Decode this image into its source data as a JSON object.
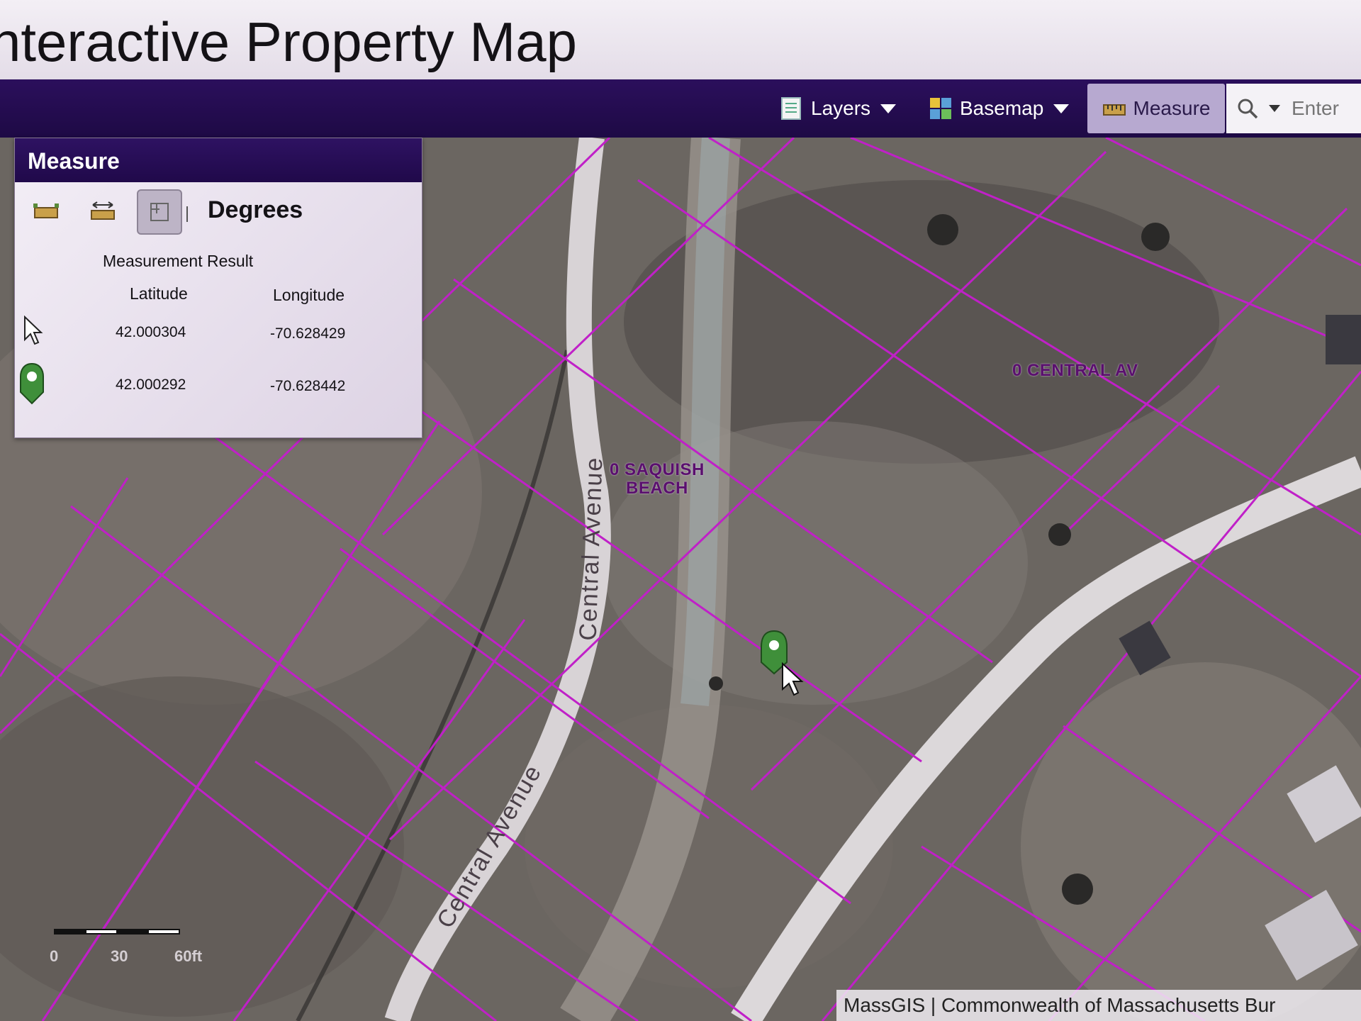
{
  "header": {
    "title": "nteractive Property Map"
  },
  "toolbar": {
    "layers_label": "Layers",
    "basemap_label": "Basemap",
    "measure_label": "Measure",
    "search_placeholder": "Enter",
    "icons": [
      "layers-icon",
      "basemap-grid-icon",
      "measure-ruler-icon",
      "search-icon"
    ]
  },
  "measure_panel": {
    "title": "Measure",
    "tools": [
      "area-tool-icon",
      "distance-tool-icon",
      "location-tool-icon"
    ],
    "active_tool": "location-tool-icon",
    "units_label": "Degrees",
    "result_title": "Measurement Result",
    "columns": {
      "latitude": "Latitude",
      "longitude": "Longitude"
    },
    "rows": [
      {
        "icon": "cursor-icon",
        "latitude": "42.000304",
        "longitude": "-70.628429"
      },
      {
        "icon": "green-marker-icon",
        "latitude": "42.000292",
        "longitude": "-70.628442"
      }
    ]
  },
  "map": {
    "road_labels": [
      "Central Avenue",
      "Central Avenue"
    ],
    "parcel_labels": [
      {
        "line1": "0 SAQUISH",
        "line2": "BEACH"
      },
      {
        "line1": "0 CENTRAL AV",
        "line2": ""
      }
    ],
    "scalebar": {
      "labels": [
        "0",
        "30",
        "60ft"
      ]
    },
    "attribution": "MassGIS | Commonwealth of Massachusetts Bur",
    "colors": {
      "parcel_lines": "#c020c8",
      "toolbar": "#22094d",
      "marker": "#3f8f3a"
    }
  }
}
